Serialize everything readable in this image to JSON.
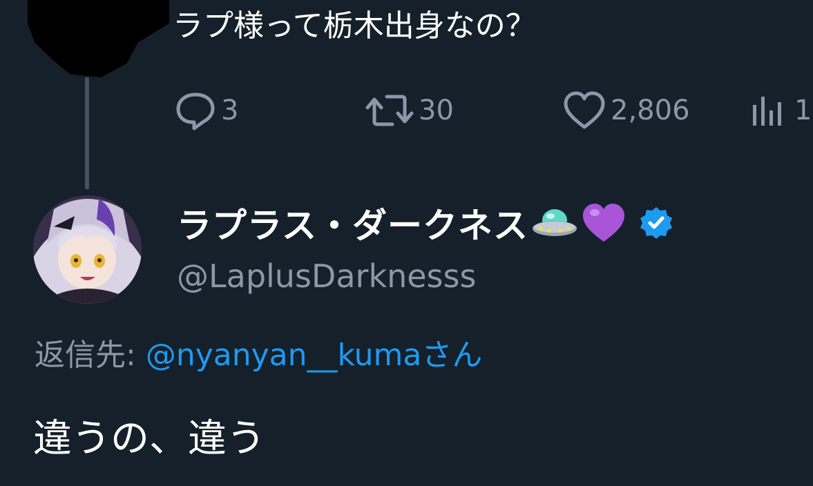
{
  "parent_tweet": {
    "text": "ラプ様って栃木出身なの？",
    "stats": {
      "replies": "3",
      "retweets": "30",
      "likes": "2,806",
      "views": "1"
    }
  },
  "reply_tweet": {
    "display_name": "ラプラス・ダークネス",
    "name_emojis": [
      "ufo-emoji",
      "purple-heart-emoji"
    ],
    "verified": true,
    "handle": "@LaplusDarknesss",
    "reply_prefix": "返信先: ",
    "reply_mention": "@nyanyan__kumaさん",
    "text": "違うの、違う"
  },
  "icons": {
    "reply": "speech-bubble-icon",
    "retweet": "retweet-arrows-icon",
    "like": "heart-icon",
    "views": "bar-chart-icon",
    "verified": "verified-badge-icon"
  },
  "colors": {
    "background": "#15202b",
    "text_primary": "#e7e9ea",
    "text_secondary": "#8b98a5",
    "link": "#1d9bf0",
    "verified": "#1d9bf0"
  }
}
